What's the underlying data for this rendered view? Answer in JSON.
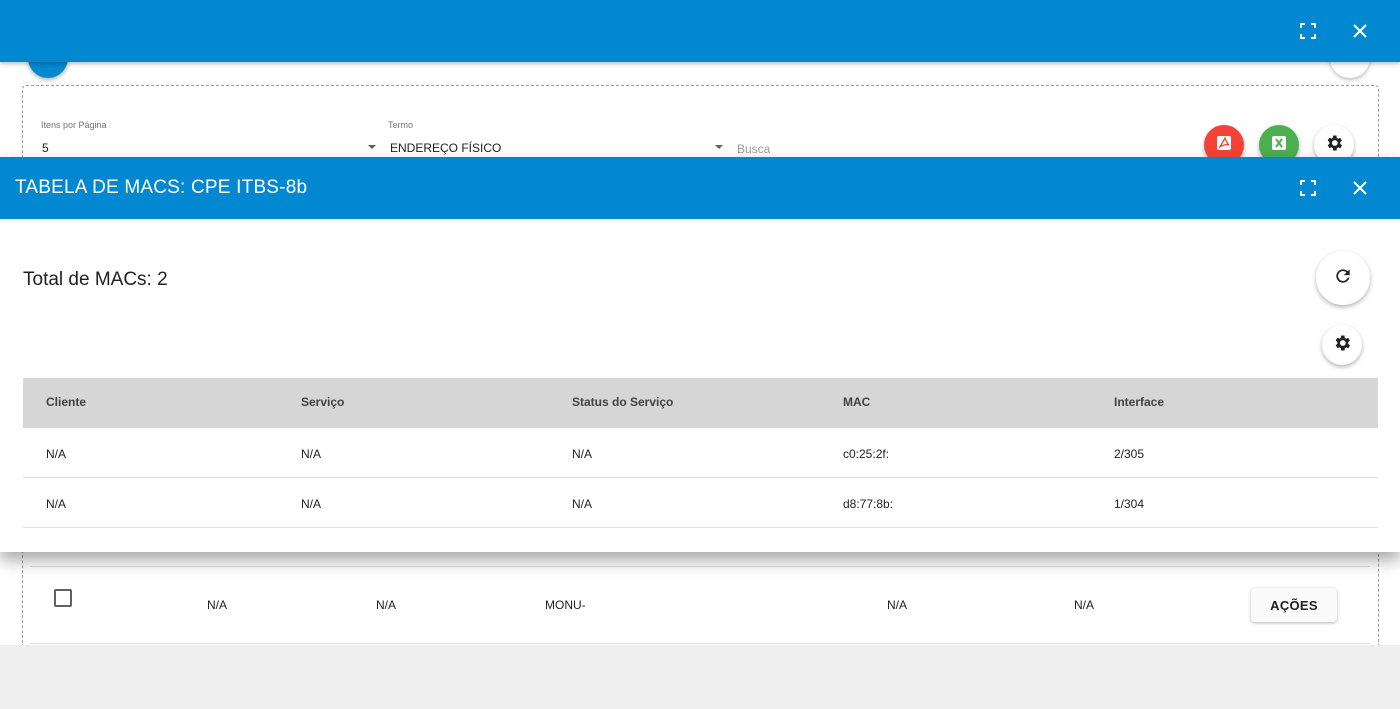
{
  "background": {
    "filters": {
      "items_label": "Itens por Página",
      "items_value": "5",
      "term_label": "Termo",
      "term_value": "ENDEREÇO FÍSICO",
      "search_placeholder": "Busca"
    },
    "row": {
      "cells": [
        "N/A",
        "N/A",
        "MONU-",
        "N/A",
        "N/A"
      ],
      "actions_label": "AÇÕES"
    },
    "colors": {
      "topbar": "#0288d1",
      "pdf": "#f44336",
      "excel": "#4caf50"
    },
    "icons": [
      "fullscreen-icon",
      "close-icon",
      "pdf-icon",
      "excel-icon",
      "gear-icon"
    ]
  },
  "modal": {
    "title": "TABELA DE MACS: CPE ITBS-8b",
    "total": "Total de MACs: 2",
    "table": {
      "headers": [
        "Cliente",
        "Serviço",
        "Status do Serviço",
        "MAC",
        "Interface"
      ],
      "rows": [
        [
          "N/A",
          "N/A",
          "N/A",
          "c0:25:2f:",
          "2/305"
        ],
        [
          "N/A",
          "N/A",
          "N/A",
          "d8:77:8b:",
          "1/304"
        ]
      ]
    },
    "icons": [
      "fullscreen-icon",
      "close-icon",
      "refresh-icon",
      "gear-icon"
    ]
  }
}
